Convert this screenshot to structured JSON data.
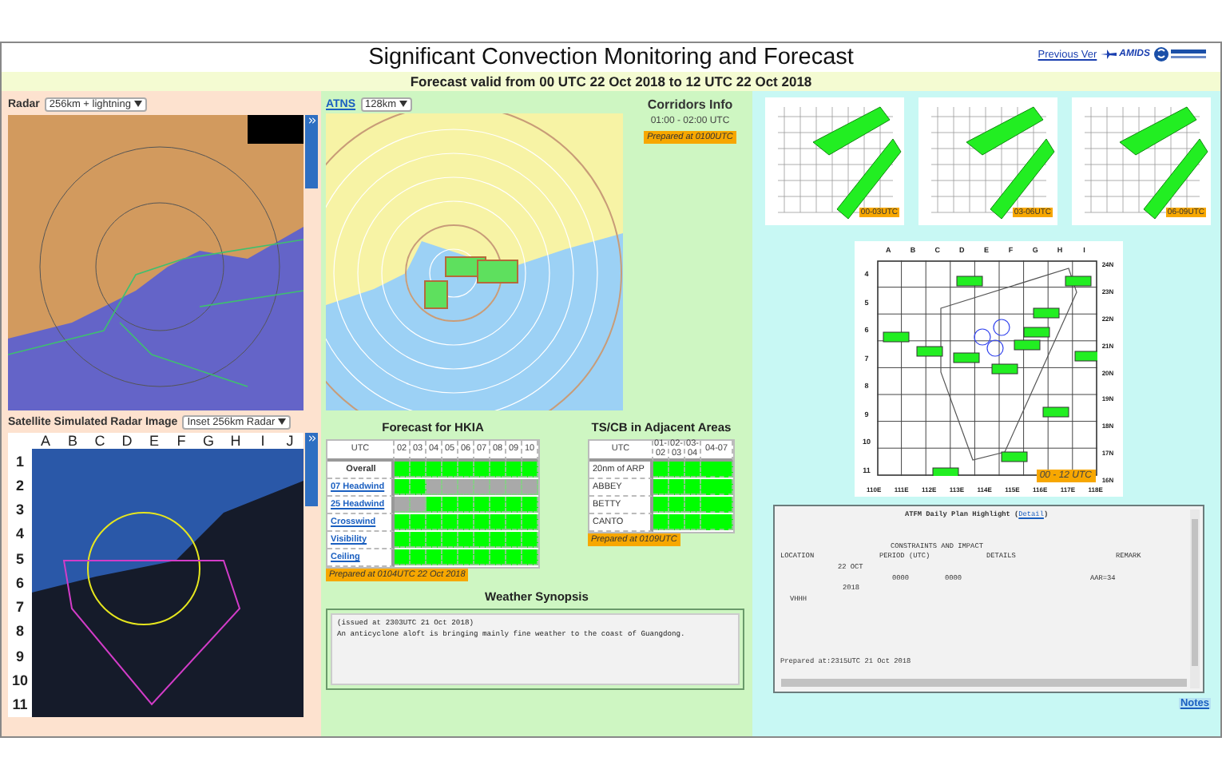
{
  "header": {
    "title": "Significant Convection Monitoring and Forecast",
    "link": "Previous Ver",
    "logo_text": "AMIDS"
  },
  "subtitle": "Forecast valid from 00 UTC 22 Oct 2018 to 12 UTC 22 Oct 2018",
  "radar": {
    "label": "Radar",
    "select": "256km + lightning"
  },
  "satellite": {
    "label": "Satellite Simulated Radar Image",
    "select": "Inset 256km Radar",
    "columns": [
      "A",
      "B",
      "C",
      "D",
      "E",
      "F",
      "G",
      "H",
      "I",
      "J"
    ],
    "rows": [
      "1",
      "2",
      "3",
      "4",
      "5",
      "6",
      "7",
      "8",
      "9",
      "10",
      "11"
    ]
  },
  "atns": {
    "link": "ATNS",
    "select": "128km"
  },
  "corridors": {
    "title": "Corridors Info",
    "period": "01:00 - 02:00 UTC",
    "prepared": "Prepared at 0100UTC"
  },
  "hkia": {
    "title": "Forecast for HKIA",
    "header": "UTC",
    "hours": [
      "02",
      "03",
      "04",
      "05",
      "06",
      "07",
      "08",
      "09",
      "10"
    ],
    "rows": [
      {
        "label": "Overall",
        "kind": "plain",
        "cells": [
          {
            "color": "#00ff00"
          },
          {
            "color": "#00ff00"
          },
          {
            "color": "#00ff00"
          },
          {
            "color": "#00ff00"
          },
          {
            "color": "#00ff00"
          },
          {
            "color": "#00ff00"
          },
          {
            "color": "#00ff00"
          },
          {
            "color": "#00ff00"
          },
          {
            "color": "#00ff00"
          }
        ]
      },
      {
        "label": "07 Headwind",
        "kind": "link",
        "cells": [
          {
            "color": "#00ff00"
          },
          {
            "color": "#00ff00"
          },
          {
            "color": "#a9a9a9"
          },
          {
            "color": "#a9a9a9"
          },
          {
            "color": "#a9a9a9"
          },
          {
            "color": "#a9a9a9"
          },
          {
            "color": "#a9a9a9"
          },
          {
            "color": "#a9a9a9"
          },
          {
            "color": "#a9a9a9"
          }
        ]
      },
      {
        "label": "25 Headwind",
        "kind": "link",
        "cells": [
          {
            "color": "#a9a9a9"
          },
          {
            "color": "#a9a9a9"
          },
          {
            "color": "#00ff00"
          },
          {
            "color": "#00ff00"
          },
          {
            "color": "#00ff00"
          },
          {
            "color": "#00ff00"
          },
          {
            "color": "#00ff00"
          },
          {
            "color": "#00ff00"
          },
          {
            "color": "#00ff00"
          }
        ]
      },
      {
        "label": "Crosswind",
        "kind": "link",
        "cells": [
          {
            "color": "#00ff00"
          },
          {
            "color": "#00ff00"
          },
          {
            "color": "#00ff00"
          },
          {
            "color": "#00ff00"
          },
          {
            "color": "#00ff00"
          },
          {
            "color": "#00ff00"
          },
          {
            "color": "#00ff00"
          },
          {
            "color": "#00ff00"
          },
          {
            "color": "#00ff00"
          }
        ]
      },
      {
        "label": "Visibility",
        "kind": "link",
        "cells": [
          {
            "color": "#00ff00"
          },
          {
            "color": "#00ff00"
          },
          {
            "color": "#00ff00"
          },
          {
            "color": "#00ff00"
          },
          {
            "color": "#00ff00"
          },
          {
            "color": "#00ff00"
          },
          {
            "color": "#00ff00"
          },
          {
            "color": "#00ff00"
          },
          {
            "color": "#00ff00"
          }
        ]
      },
      {
        "label": "Ceiling",
        "kind": "link",
        "cells": [
          {
            "color": "#00ff00"
          },
          {
            "color": "#00ff00"
          },
          {
            "color": "#00ff00"
          },
          {
            "color": "#00ff00"
          },
          {
            "color": "#00ff00"
          },
          {
            "color": "#00ff00"
          },
          {
            "color": "#00ff00"
          },
          {
            "color": "#00ff00"
          },
          {
            "color": "#00ff00"
          }
        ]
      }
    ],
    "prepared": "Prepared at 0104UTC 22 Oct 2018"
  },
  "tscb": {
    "title": "TS/CB in Adjacent Areas",
    "header": "UTC",
    "hours": [
      "01-02",
      "02-03",
      "03-04",
      "04-07"
    ],
    "rows": [
      {
        "label": "20nm of ARP",
        "cells": [
          {
            "color": "#00ff00"
          },
          {
            "color": "#00ff00"
          },
          {
            "color": "#00ff00"
          },
          {
            "color": "#00ff00"
          }
        ]
      },
      {
        "label": "ABBEY",
        "cells": [
          {
            "color": "#00ff00"
          },
          {
            "color": "#00ff00"
          },
          {
            "color": "#00ff00"
          },
          {
            "color": "#00ff00"
          }
        ]
      },
      {
        "label": "BETTY",
        "cells": [
          {
            "color": "#00ff00"
          },
          {
            "color": "#00ff00"
          },
          {
            "color": "#00ff00"
          },
          {
            "color": "#00ff00"
          }
        ]
      },
      {
        "label": "CANTO",
        "cells": [
          {
            "color": "#00ff00"
          },
          {
            "color": "#00ff00"
          },
          {
            "color": "#00ff00"
          },
          {
            "color": "#00ff00"
          }
        ]
      }
    ],
    "prepared": "Prepared at 0109UTC"
  },
  "synopsis": {
    "title": "Weather Synopsis",
    "issued": "(issued at 2303UTC 21 Oct 2018)",
    "text": "An anticyclone aloft is bringing mainly fine weather to the coast of Guangdong."
  },
  "outlooks": [
    {
      "label": "00-03UTC"
    },
    {
      "label": "03-06UTC"
    },
    {
      "label": "06-09UTC"
    }
  ],
  "grid_chart": {
    "columns": [
      "A",
      "B",
      "C",
      "D",
      "E",
      "F",
      "G",
      "H",
      "I"
    ],
    "rows": [
      "4",
      "5",
      "6",
      "7",
      "8",
      "9",
      "10",
      "11"
    ],
    "longitudes": [
      "110E",
      "111E",
      "112E",
      "113E",
      "114E",
      "115E",
      "116E",
      "117E",
      "118E"
    ],
    "latitudes": [
      "24N",
      "23N",
      "22N",
      "21N",
      "20N",
      "19N",
      "18N",
      "17N",
      "16N"
    ],
    "period": "00 - 12 UTC"
  },
  "atfm": {
    "title": "ATFM Daily Plan Highlight (",
    "link": "Detail",
    "title_end": ")",
    "heading": "CONSTRAINTS AND IMPACT",
    "columns": [
      "LOCATION",
      "PERIOD (UTC)",
      "DETAILS",
      "REMARK"
    ],
    "date": "22 OCT",
    "start": "0000",
    "end": "0000",
    "remark": "AAR=34",
    "year": "2018",
    "location": "VHHH",
    "prepared": "Prepared at:2315UTC 21 Oct 2018"
  },
  "notes": "Notes"
}
